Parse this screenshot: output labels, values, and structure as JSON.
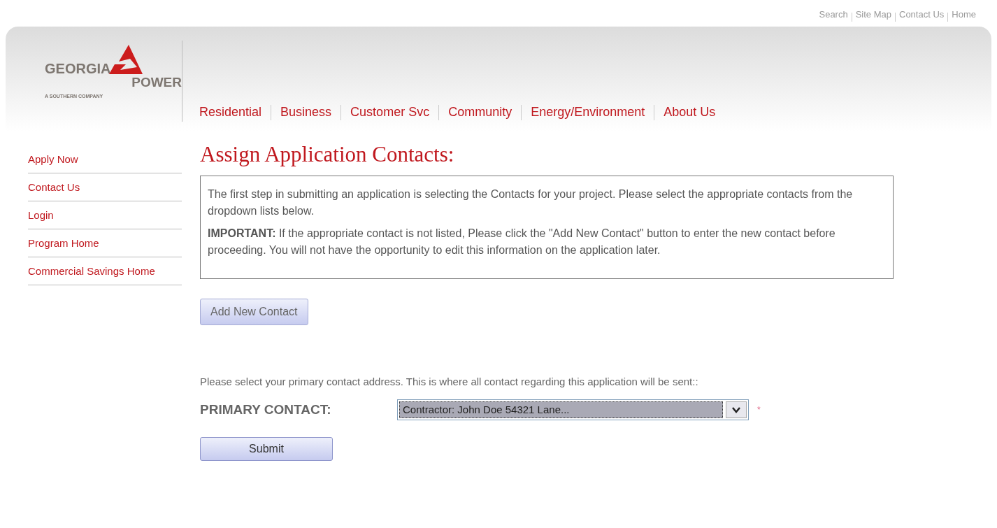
{
  "utility_links": [
    "Search",
    "Site Map",
    "Contact Us",
    "Home"
  ],
  "logo": {
    "line_1": "GEORGIA",
    "line_2": "POWER",
    "tagline": "A SOUTHERN COMPANY"
  },
  "main_nav": [
    "Residential",
    "Business",
    "Customer Svc",
    "Community",
    "Energy/Environment",
    "About Us"
  ],
  "sidebar": {
    "items": [
      "Apply Now",
      "Contact Us",
      "Login",
      "Program Home",
      "Commercial Savings Home"
    ]
  },
  "page_title": "Assign Application Contacts:",
  "notice": {
    "paragraphs": [
      "The first step in submitting an application is selecting the Contacts for your project. Please select the appropriate contacts from the dropdown lists below.",
      "**IMPORTANT:** If the appropriate contact is not listed, Please click the \"Add New Contact\" button to enter the new contact before proceeding. You will not have the opportunity to edit this information on the application later."
    ]
  },
  "add_button": "Add New Contact",
  "instruction": "Please select your primary contact address. This is where all contact regarding this application will be sent::",
  "primary_contact": {
    "label": "PRIMARY CONTACT:",
    "value": "Contractor: John Doe 54321 Lane...",
    "required_mark": "*"
  },
  "submit_button": "Submit"
}
